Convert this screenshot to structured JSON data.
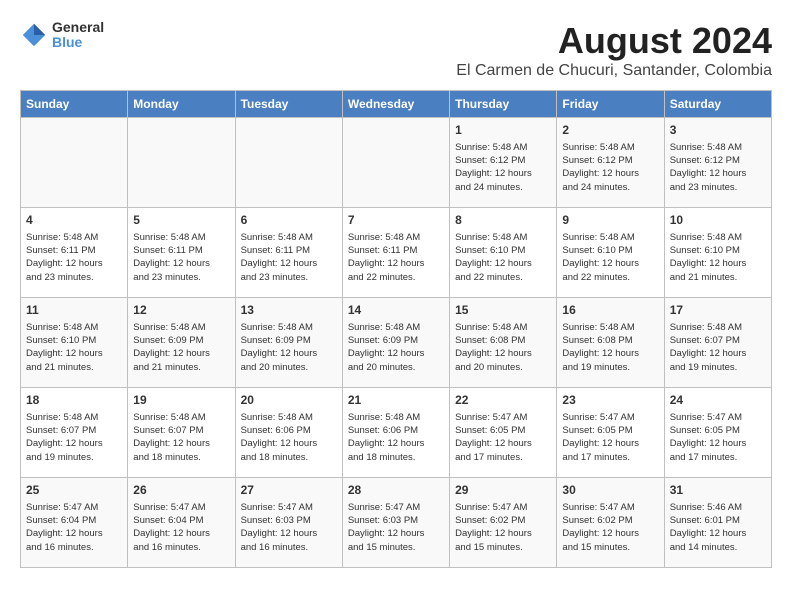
{
  "header": {
    "logo": {
      "line1": "General",
      "line2": "Blue"
    },
    "title": "August 2024",
    "subtitle": "El Carmen de Chucuri, Santander, Colombia"
  },
  "weekdays": [
    "Sunday",
    "Monday",
    "Tuesday",
    "Wednesday",
    "Thursday",
    "Friday",
    "Saturday"
  ],
  "weeks": [
    [
      {
        "day": "",
        "info": ""
      },
      {
        "day": "",
        "info": ""
      },
      {
        "day": "",
        "info": ""
      },
      {
        "day": "",
        "info": ""
      },
      {
        "day": "1",
        "info": "Sunrise: 5:48 AM\nSunset: 6:12 PM\nDaylight: 12 hours\nand 24 minutes."
      },
      {
        "day": "2",
        "info": "Sunrise: 5:48 AM\nSunset: 6:12 PM\nDaylight: 12 hours\nand 24 minutes."
      },
      {
        "day": "3",
        "info": "Sunrise: 5:48 AM\nSunset: 6:12 PM\nDaylight: 12 hours\nand 23 minutes."
      }
    ],
    [
      {
        "day": "4",
        "info": "Sunrise: 5:48 AM\nSunset: 6:11 PM\nDaylight: 12 hours\nand 23 minutes."
      },
      {
        "day": "5",
        "info": "Sunrise: 5:48 AM\nSunset: 6:11 PM\nDaylight: 12 hours\nand 23 minutes."
      },
      {
        "day": "6",
        "info": "Sunrise: 5:48 AM\nSunset: 6:11 PM\nDaylight: 12 hours\nand 23 minutes."
      },
      {
        "day": "7",
        "info": "Sunrise: 5:48 AM\nSunset: 6:11 PM\nDaylight: 12 hours\nand 22 minutes."
      },
      {
        "day": "8",
        "info": "Sunrise: 5:48 AM\nSunset: 6:10 PM\nDaylight: 12 hours\nand 22 minutes."
      },
      {
        "day": "9",
        "info": "Sunrise: 5:48 AM\nSunset: 6:10 PM\nDaylight: 12 hours\nand 22 minutes."
      },
      {
        "day": "10",
        "info": "Sunrise: 5:48 AM\nSunset: 6:10 PM\nDaylight: 12 hours\nand 21 minutes."
      }
    ],
    [
      {
        "day": "11",
        "info": "Sunrise: 5:48 AM\nSunset: 6:10 PM\nDaylight: 12 hours\nand 21 minutes."
      },
      {
        "day": "12",
        "info": "Sunrise: 5:48 AM\nSunset: 6:09 PM\nDaylight: 12 hours\nand 21 minutes."
      },
      {
        "day": "13",
        "info": "Sunrise: 5:48 AM\nSunset: 6:09 PM\nDaylight: 12 hours\nand 20 minutes."
      },
      {
        "day": "14",
        "info": "Sunrise: 5:48 AM\nSunset: 6:09 PM\nDaylight: 12 hours\nand 20 minutes."
      },
      {
        "day": "15",
        "info": "Sunrise: 5:48 AM\nSunset: 6:08 PM\nDaylight: 12 hours\nand 20 minutes."
      },
      {
        "day": "16",
        "info": "Sunrise: 5:48 AM\nSunset: 6:08 PM\nDaylight: 12 hours\nand 19 minutes."
      },
      {
        "day": "17",
        "info": "Sunrise: 5:48 AM\nSunset: 6:07 PM\nDaylight: 12 hours\nand 19 minutes."
      }
    ],
    [
      {
        "day": "18",
        "info": "Sunrise: 5:48 AM\nSunset: 6:07 PM\nDaylight: 12 hours\nand 19 minutes."
      },
      {
        "day": "19",
        "info": "Sunrise: 5:48 AM\nSunset: 6:07 PM\nDaylight: 12 hours\nand 18 minutes."
      },
      {
        "day": "20",
        "info": "Sunrise: 5:48 AM\nSunset: 6:06 PM\nDaylight: 12 hours\nand 18 minutes."
      },
      {
        "day": "21",
        "info": "Sunrise: 5:48 AM\nSunset: 6:06 PM\nDaylight: 12 hours\nand 18 minutes."
      },
      {
        "day": "22",
        "info": "Sunrise: 5:47 AM\nSunset: 6:05 PM\nDaylight: 12 hours\nand 17 minutes."
      },
      {
        "day": "23",
        "info": "Sunrise: 5:47 AM\nSunset: 6:05 PM\nDaylight: 12 hours\nand 17 minutes."
      },
      {
        "day": "24",
        "info": "Sunrise: 5:47 AM\nSunset: 6:05 PM\nDaylight: 12 hours\nand 17 minutes."
      }
    ],
    [
      {
        "day": "25",
        "info": "Sunrise: 5:47 AM\nSunset: 6:04 PM\nDaylight: 12 hours\nand 16 minutes."
      },
      {
        "day": "26",
        "info": "Sunrise: 5:47 AM\nSunset: 6:04 PM\nDaylight: 12 hours\nand 16 minutes."
      },
      {
        "day": "27",
        "info": "Sunrise: 5:47 AM\nSunset: 6:03 PM\nDaylight: 12 hours\nand 16 minutes."
      },
      {
        "day": "28",
        "info": "Sunrise: 5:47 AM\nSunset: 6:03 PM\nDaylight: 12 hours\nand 15 minutes."
      },
      {
        "day": "29",
        "info": "Sunrise: 5:47 AM\nSunset: 6:02 PM\nDaylight: 12 hours\nand 15 minutes."
      },
      {
        "day": "30",
        "info": "Sunrise: 5:47 AM\nSunset: 6:02 PM\nDaylight: 12 hours\nand 15 minutes."
      },
      {
        "day": "31",
        "info": "Sunrise: 5:46 AM\nSunset: 6:01 PM\nDaylight: 12 hours\nand 14 minutes."
      }
    ]
  ]
}
